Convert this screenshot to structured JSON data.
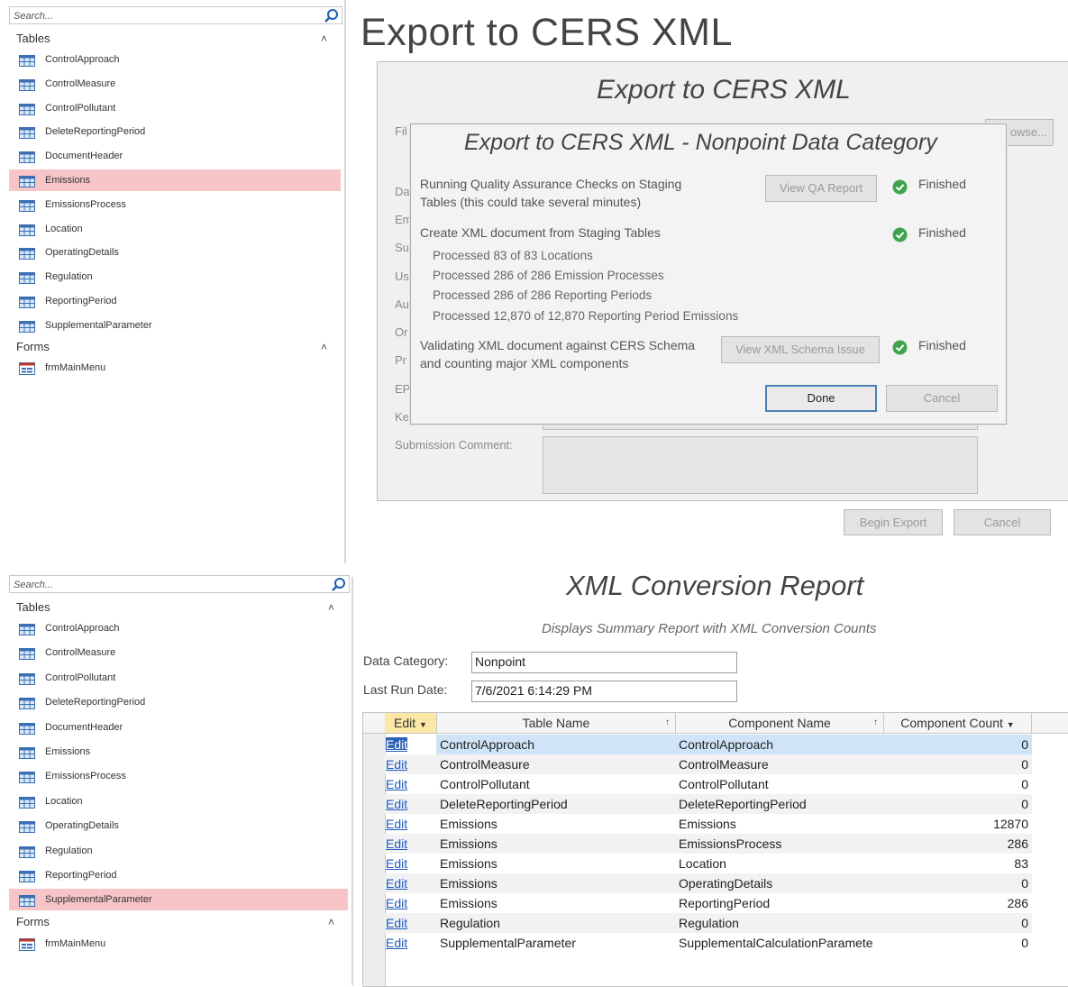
{
  "nav_top": {
    "search_placeholder": "Search...",
    "tables_header": "Tables",
    "forms_header": "Forms",
    "tables": [
      "ControlApproach",
      "ControlMeasure",
      "ControlPollutant",
      "DeleteReportingPeriod",
      "DocumentHeader",
      "Emissions",
      "EmissionsProcess",
      "Location",
      "OperatingDetails",
      "Regulation",
      "ReportingPeriod",
      "SupplementalParameter"
    ],
    "selected_index": 5,
    "forms": [
      "frmMainMenu"
    ]
  },
  "nav_bottom": {
    "search_placeholder": "Search...",
    "tables_header": "Tables",
    "forms_header": "Forms",
    "tables": [
      "ControlApproach",
      "ControlMeasure",
      "ControlPollutant",
      "DeleteReportingPeriod",
      "DocumentHeader",
      "Emissions",
      "EmissionsProcess",
      "Location",
      "OperatingDetails",
      "Regulation",
      "ReportingPeriod",
      "SupplementalParameter"
    ],
    "selected_index": 11,
    "forms": [
      "frmMainMenu"
    ]
  },
  "export_form": {
    "page_title": "Export to CERS XML",
    "form_title": "Export to CERS XML",
    "partial_labels": [
      "Fil",
      "Da",
      "Em",
      "Su",
      "Us",
      "Au",
      "Or",
      "Pr",
      "EP",
      "Ke"
    ],
    "browse_partial": "owse...",
    "submission_comment_label": "Submission Comment:",
    "begin_export_label": "Begin Export",
    "cancel_label": "Cancel"
  },
  "dialog": {
    "title": "Export to CERS XML - Nonpoint Data Category",
    "qa_line1": "Running Quality Assurance Checks on Staging",
    "qa_line2": "Tables (this could take several minutes)",
    "qa_button": "View QA Report",
    "qa_status": "Finished",
    "xml_heading": "Create XML document from Staging Tables",
    "xml_status": "Finished",
    "processed": [
      "Processed 83 of 83 Locations",
      "Processed 286 of 286 Emission Processes",
      "Processed 286 of 286 Reporting Periods",
      "Processed 12,870 of 12,870 Reporting Period Emissions"
    ],
    "validate_line1": "Validating XML document against CERS Schema",
    "validate_line2": "and counting major XML components",
    "schema_button": "View XML Schema Issue",
    "validate_status": "Finished",
    "done_label": "Done",
    "cancel_label": "Cancel"
  },
  "report": {
    "title": "XML Conversion Report",
    "subtitle": "Displays Summary Report with XML Conversion Counts",
    "data_category_label": "Data Category:",
    "data_category_value": "Nonpoint",
    "last_run_label": "Last Run Date:",
    "last_run_value": "7/6/2021 6:14:29 PM",
    "columns": [
      "Edit",
      "Table Name",
      "Component Name",
      "Component Count"
    ],
    "rows": [
      {
        "edit": "Edit",
        "table": "ControlApproach",
        "component": "ControlApproach",
        "count": "0"
      },
      {
        "edit": "Edit",
        "table": "ControlMeasure",
        "component": "ControlMeasure",
        "count": "0"
      },
      {
        "edit": "Edit",
        "table": "ControlPollutant",
        "component": "ControlPollutant",
        "count": "0"
      },
      {
        "edit": "Edit",
        "table": "DeleteReportingPeriod",
        "component": "DeleteReportingPeriod",
        "count": "0"
      },
      {
        "edit": "Edit",
        "table": "Emissions",
        "component": "Emissions",
        "count": "12870"
      },
      {
        "edit": "Edit",
        "table": "Emissions",
        "component": "EmissionsProcess",
        "count": "286"
      },
      {
        "edit": "Edit",
        "table": "Emissions",
        "component": "Location",
        "count": "83"
      },
      {
        "edit": "Edit",
        "table": "Emissions",
        "component": "OperatingDetails",
        "count": "0"
      },
      {
        "edit": "Edit",
        "table": "Emissions",
        "component": "ReportingPeriod",
        "count": "286"
      },
      {
        "edit": "Edit",
        "table": "Regulation",
        "component": "Regulation",
        "count": "0"
      },
      {
        "edit": "Edit",
        "table": "SupplementalParameter",
        "component": "SupplementalCalculationParamete",
        "count": "0"
      }
    ]
  },
  "colors": {
    "selected_nav": "#f7c5c7",
    "current_row": "#cfe4f7",
    "link": "#1f5bbf",
    "check_green": "#3fa34d"
  },
  "icons": {
    "search": "search-icon",
    "collapse": "double-chevron-up-icon",
    "table": "table-icon",
    "form": "form-icon",
    "check": "check-circle-icon",
    "sort": "sort-dropdown-icon"
  }
}
